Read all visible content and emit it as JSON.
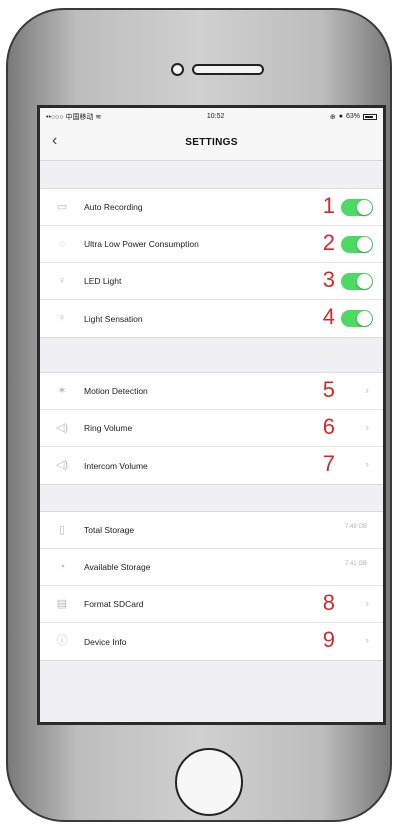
{
  "status_bar": {
    "carrier": "••○○○ 中国移动",
    "wifi": "wifi-icon",
    "time": "10:52",
    "battery_pct": "63%"
  },
  "nav": {
    "title": "SETTINGS",
    "back_icon": "‹"
  },
  "groups": {
    "toggles": [
      {
        "label": "Auto Recording",
        "icon": "camera-icon",
        "glyph": "▭",
        "number": "1",
        "on": true
      },
      {
        "label": "Ultra Low Power Consumption",
        "icon": "power-icon",
        "glyph": "◌",
        "number": "2",
        "on": true
      },
      {
        "label": "LED Light",
        "icon": "bulb-icon",
        "glyph": "♀",
        "number": "3",
        "on": true
      },
      {
        "label": "Light Sensation",
        "icon": "bulb-sense-icon",
        "glyph": "♀",
        "number": "4",
        "on": true
      }
    ],
    "detection": [
      {
        "label": "Motion Detection",
        "icon": "running-person-icon",
        "glyph": "✶",
        "number": "5"
      },
      {
        "label": "Ring Volume",
        "icon": "speaker-icon",
        "glyph": "◁)",
        "number": "6"
      },
      {
        "label": "Intercom Volume",
        "icon": "speaker-icon",
        "glyph": "◁)",
        "number": "7"
      }
    ],
    "storage": [
      {
        "label": "Total Storage",
        "icon": "sdcard-icon",
        "glyph": "▯",
        "value": "7.49 GB"
      },
      {
        "label": "Available Storage",
        "icon": "pie-icon",
        "glyph": "◔",
        "value": "7.41 GB"
      },
      {
        "label": "Format SDCard",
        "icon": "format-icon",
        "glyph": "▤",
        "number": "8"
      },
      {
        "label": "Device Info",
        "icon": "info-icon",
        "glyph": "ⓘ",
        "number": "9"
      }
    ]
  },
  "chevron": "›",
  "colors": {
    "toggle_on": "#4cd964",
    "annotation_red": "#d42a2a",
    "screen_bg": "#efeff4"
  }
}
